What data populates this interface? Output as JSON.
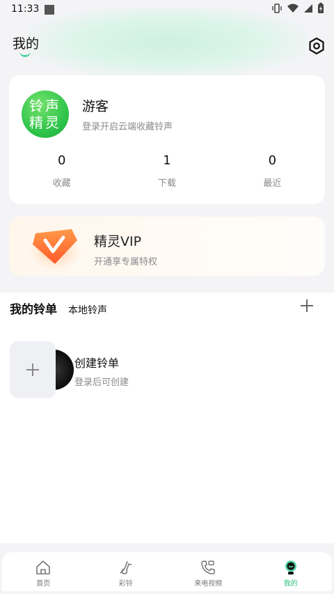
{
  "status": {
    "time": "11:33"
  },
  "header": {
    "title": "我的"
  },
  "profile": {
    "avatar_line1": "铃声",
    "avatar_line2": "精灵",
    "name": "游客",
    "subtitle": "登录开启云端收藏铃声",
    "stats": [
      {
        "value": "0",
        "label": "收藏"
      },
      {
        "value": "1",
        "label": "下载"
      },
      {
        "value": "0",
        "label": "最近"
      }
    ]
  },
  "vip": {
    "title": "精灵VIP",
    "subtitle": "开通享专属特权"
  },
  "playlist_tabs": {
    "active": "我的铃单",
    "inactive": "本地铃声"
  },
  "create_playlist": {
    "title": "创建铃单",
    "subtitle": "登录后可创建"
  },
  "bottom_nav": [
    {
      "label": "首页",
      "icon": "home-icon"
    },
    {
      "label": "彩铃",
      "icon": "ringtone-icon"
    },
    {
      "label": "来电视频",
      "icon": "call-video-icon"
    },
    {
      "label": "我的",
      "icon": "profile-icon"
    }
  ],
  "colors": {
    "accent": "#2bbf7a",
    "avatar": "#2cc24a"
  }
}
